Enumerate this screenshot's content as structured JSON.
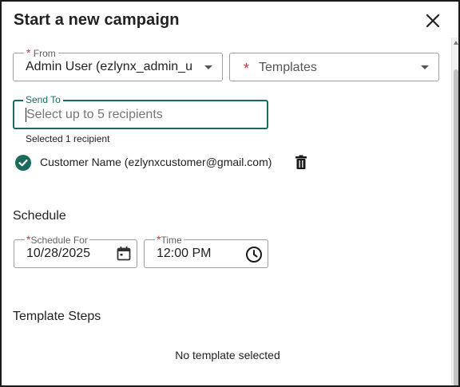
{
  "dialog": {
    "title": "Start a new campaign"
  },
  "from": {
    "label": "From",
    "value": "Admin User (ezlynx_admin_u"
  },
  "templates": {
    "placeholder": "Templates"
  },
  "send_to": {
    "label": "Send To",
    "placeholder": "Select up to 5 recipients",
    "selected_count_text": "Selected 1 recipient"
  },
  "recipients": [
    {
      "name": "Customer Name (ezlynxcustomer@gmail.com)"
    }
  ],
  "schedule": {
    "heading": "Schedule",
    "date_label": "Schedule For",
    "date_value": "10/28/2025",
    "time_label": "Time",
    "time_value": "12:00 PM"
  },
  "template_steps": {
    "heading": "Template Steps",
    "empty_text": "No template selected"
  },
  "colors": {
    "accent": "#1b6b5c",
    "required": "#d32f2f"
  },
  "icons": [
    "close-icon",
    "chevron-down-icon",
    "check-circle-icon",
    "trash-icon",
    "calendar-icon",
    "clock-icon"
  ]
}
